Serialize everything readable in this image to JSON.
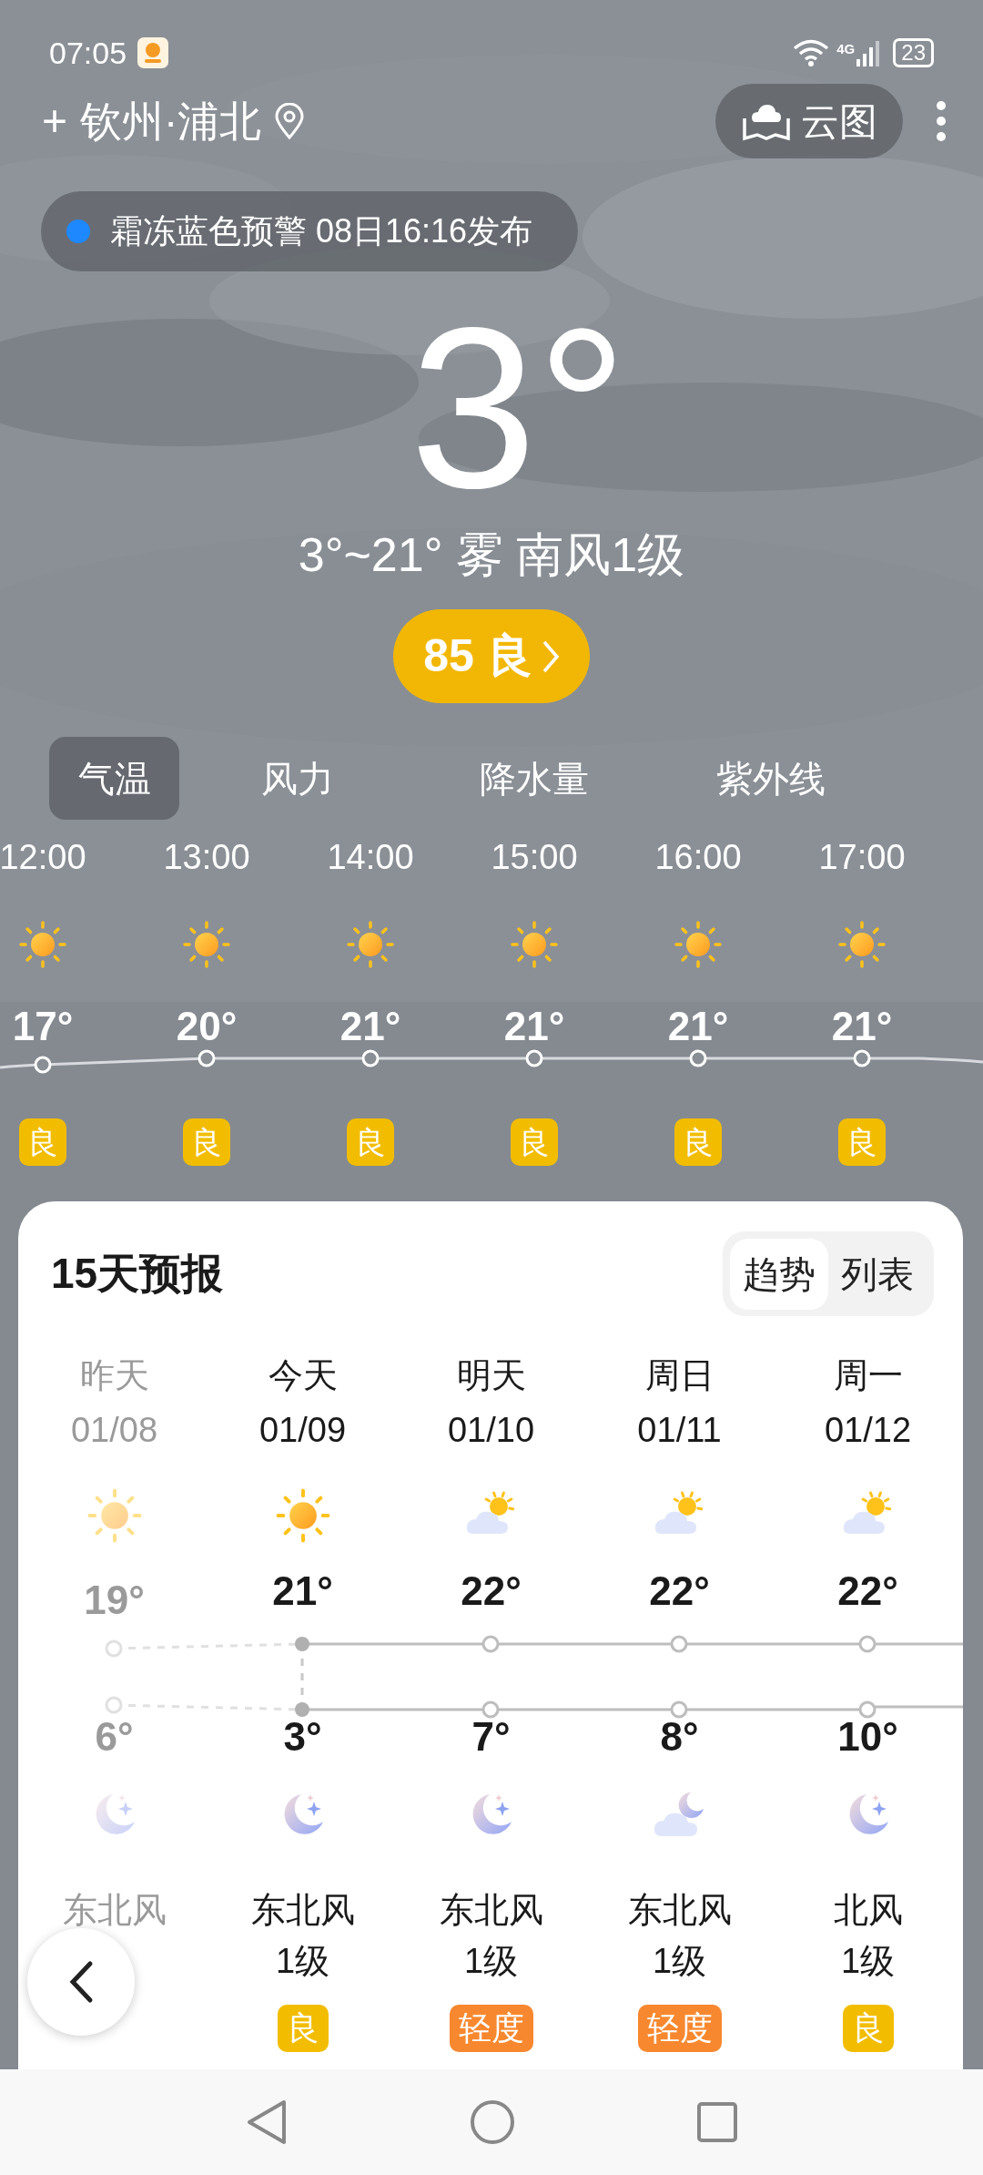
{
  "status_bar": {
    "time": "07:05",
    "network": "4G",
    "battery": "23"
  },
  "header": {
    "location": "钦州·浦北",
    "add": "+",
    "cloud_map": "云图"
  },
  "alert": {
    "text": "霜冻蓝色预警 08日16:16发布",
    "color": "#1e88ff"
  },
  "current": {
    "temperature": "3°",
    "summary": "3°~21° 雾 南风1级",
    "aqi": "85 良"
  },
  "tabs": [
    {
      "label": "气温",
      "selected": true
    },
    {
      "label": "风力",
      "selected": false
    },
    {
      "label": "降水量",
      "selected": false
    },
    {
      "label": "紫外线",
      "selected": false
    }
  ],
  "hourly": [
    {
      "time": "12:00",
      "temp": "17°",
      "aqi": "良",
      "color": "#f2bd00"
    },
    {
      "time": "13:00",
      "temp": "20°",
      "aqi": "良",
      "color": "#f2bd00"
    },
    {
      "time": "14:00",
      "temp": "21°",
      "aqi": "良",
      "color": "#f2bd00"
    },
    {
      "time": "15:00",
      "temp": "21°",
      "aqi": "良",
      "color": "#f2bd00"
    },
    {
      "time": "16:00",
      "temp": "21°",
      "aqi": "良",
      "color": "#f2bd00"
    },
    {
      "time": "17:00",
      "temp": "21°",
      "aqi": "良",
      "color": "#f2bd00"
    }
  ],
  "forecast": {
    "title": "15天预报",
    "views": [
      {
        "label": "趋势",
        "selected": true
      },
      {
        "label": "列表",
        "selected": false
      }
    ],
    "days": [
      {
        "kind": "past",
        "day": "昨天",
        "date": "01/08",
        "high": "19°",
        "low": "6°",
        "wind": "东北风"
      },
      {
        "kind": "today",
        "day": "今天",
        "date": "01/09",
        "high": "21°",
        "low": "3°",
        "wind": "东北风",
        "wind_level": "1级",
        "aqi": "良",
        "color": "#f2bd00"
      },
      {
        "kind": "future",
        "day": "明天",
        "date": "01/10",
        "high": "22°",
        "low": "7°",
        "wind": "东北风",
        "wind_level": "1级",
        "aqi": "轻度",
        "color": "#f7882f"
      },
      {
        "kind": "future",
        "day": "周日",
        "date": "01/11",
        "high": "22°",
        "low": "8°",
        "wind": "东北风",
        "wind_level": "1级",
        "aqi": "轻度",
        "color": "#f7882f"
      },
      {
        "kind": "future",
        "day": "周一",
        "date": "01/12",
        "high": "22°",
        "low": "10°",
        "wind": "北风",
        "wind_level": "1级",
        "aqi": "良",
        "color": "#f2bd00"
      }
    ]
  }
}
